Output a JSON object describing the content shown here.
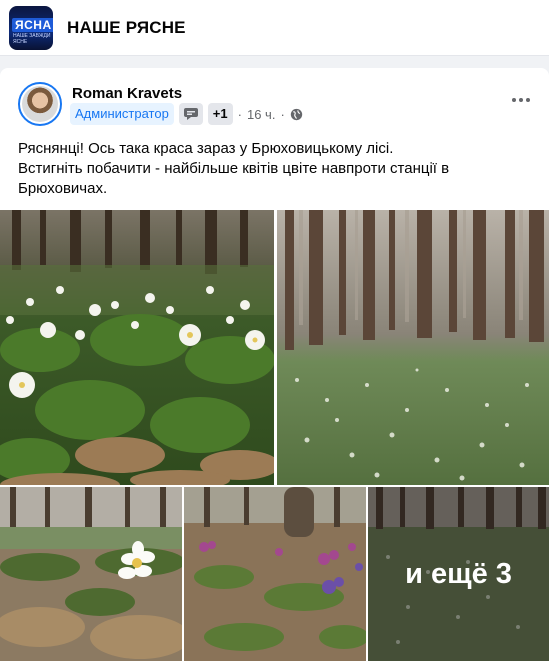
{
  "group": {
    "name": "НАШЕ РЯСНЕ",
    "logo_text": "ЯСНА",
    "logo_subtext": "НАШЕ ЗАВЖДИ ЯСНЕ"
  },
  "post": {
    "author_name": "Roman Kravets",
    "role_badge": "Администратор",
    "badge_icon": "chat-bubble-icon",
    "extra_badges": "+1",
    "separator": "·",
    "time": "16 ч.",
    "separator2": "·",
    "privacy_icon": "globe-icon",
    "text_lines": [
      "Ряснянці! Ось така краса зараз у Брюховицькому лісі.",
      "Встигніть побачити - найбільше квітів цвіте навпроти станції в",
      "Брюховичах."
    ],
    "more_photos_label": "и ещё 3"
  },
  "colors": {
    "accent": "#1877f2",
    "badge_bg": "#e7f3ff",
    "muted_text": "#65676b",
    "page_bg": "#f0f2f5"
  }
}
